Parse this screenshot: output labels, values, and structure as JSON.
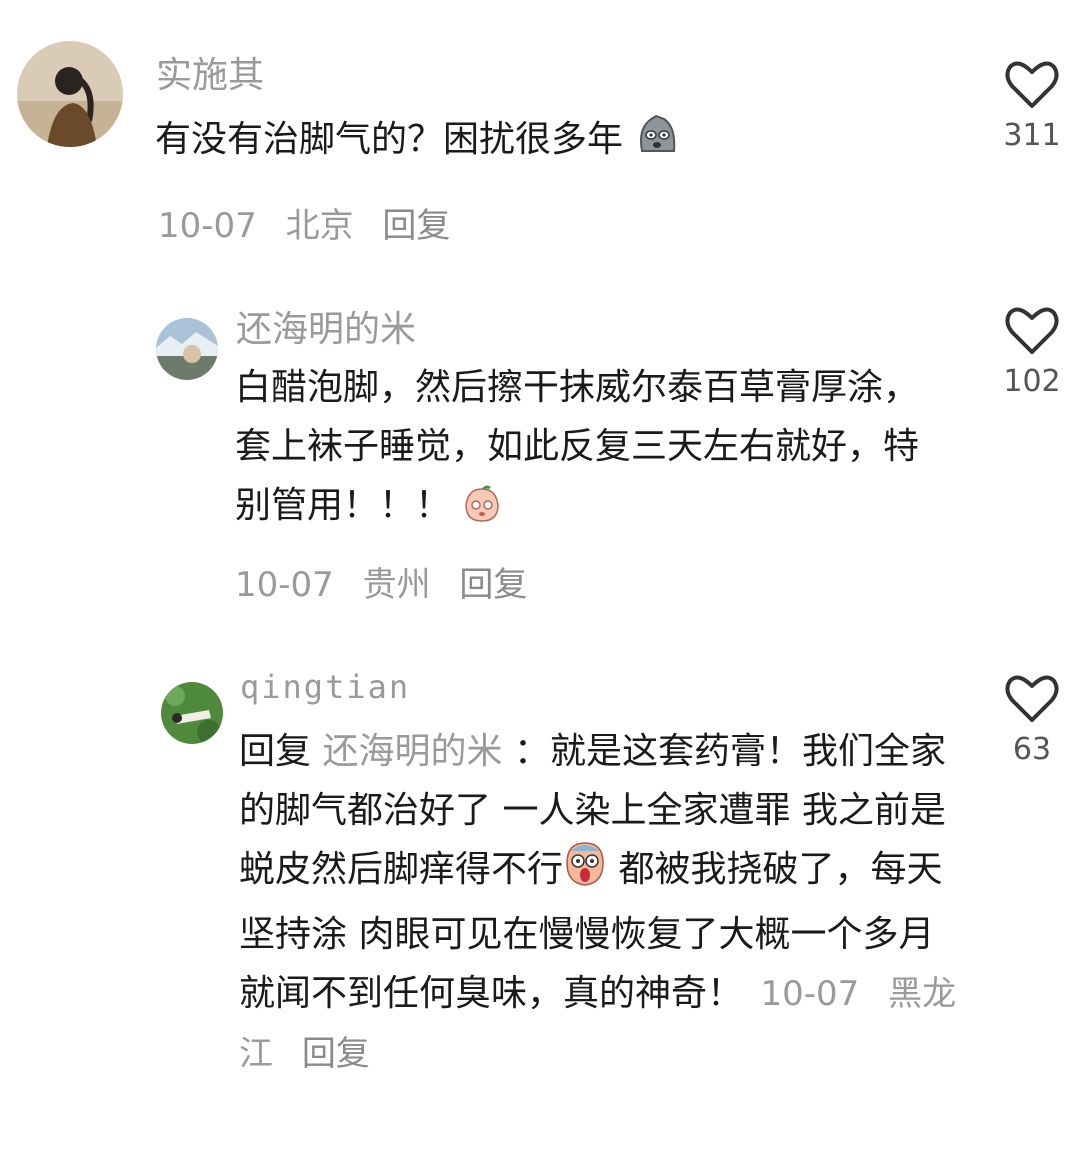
{
  "comments": [
    {
      "username": "实施其",
      "text": "有没有治脚气的？困扰很多年",
      "date": "10-07",
      "location": "北京",
      "reply_label": "回复",
      "likes": "311"
    },
    {
      "username": "还海明的米",
      "text": "白醋泡脚，然后擦干抹威尔泰百草膏厚涂，套上袜子睡觉，如此反复三天左右就好，特别管用！！！",
      "date": "10-07",
      "location": "贵州",
      "reply_label": "回复",
      "likes": "102"
    },
    {
      "username": "qingtian",
      "reply_prefix": "回复",
      "mention": "还海明的米",
      "text_part1": "：就是这套药膏！我们全家的脚气都治好了 一人染上全家遭罪 我之前是蜕皮然后脚痒得不行",
      "text_part2": "都被我挠破了，每天坚持涂 肉眼可见在慢慢恢复了大概一个多月就闻不到任何臭味，真的神奇！",
      "date": "10-07",
      "location": "黑龙江",
      "reply_label": "回复",
      "likes": "63"
    }
  ],
  "icons": {
    "like": "heart-outline-icon",
    "emoji_1": "grimace-emoji-icon",
    "emoji_2": "peach-face-emoji-icon",
    "emoji_3": "scream-emoji-icon"
  }
}
